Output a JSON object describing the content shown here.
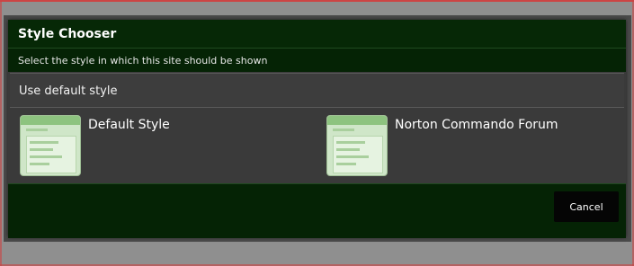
{
  "dialog": {
    "title": "Style Chooser",
    "subtitle": "Select the style in which this site should be shown",
    "default_option": "Use default style",
    "styles": [
      {
        "name": "Default Style"
      },
      {
        "name": "Norton Commando Forum"
      }
    ],
    "cancel_label": "Cancel"
  },
  "colors": {
    "header_bg": "#062806",
    "body_bg": "#3a3a3a",
    "button_bg": "#050505",
    "thumbnail_bg": "#cfe6c8"
  }
}
